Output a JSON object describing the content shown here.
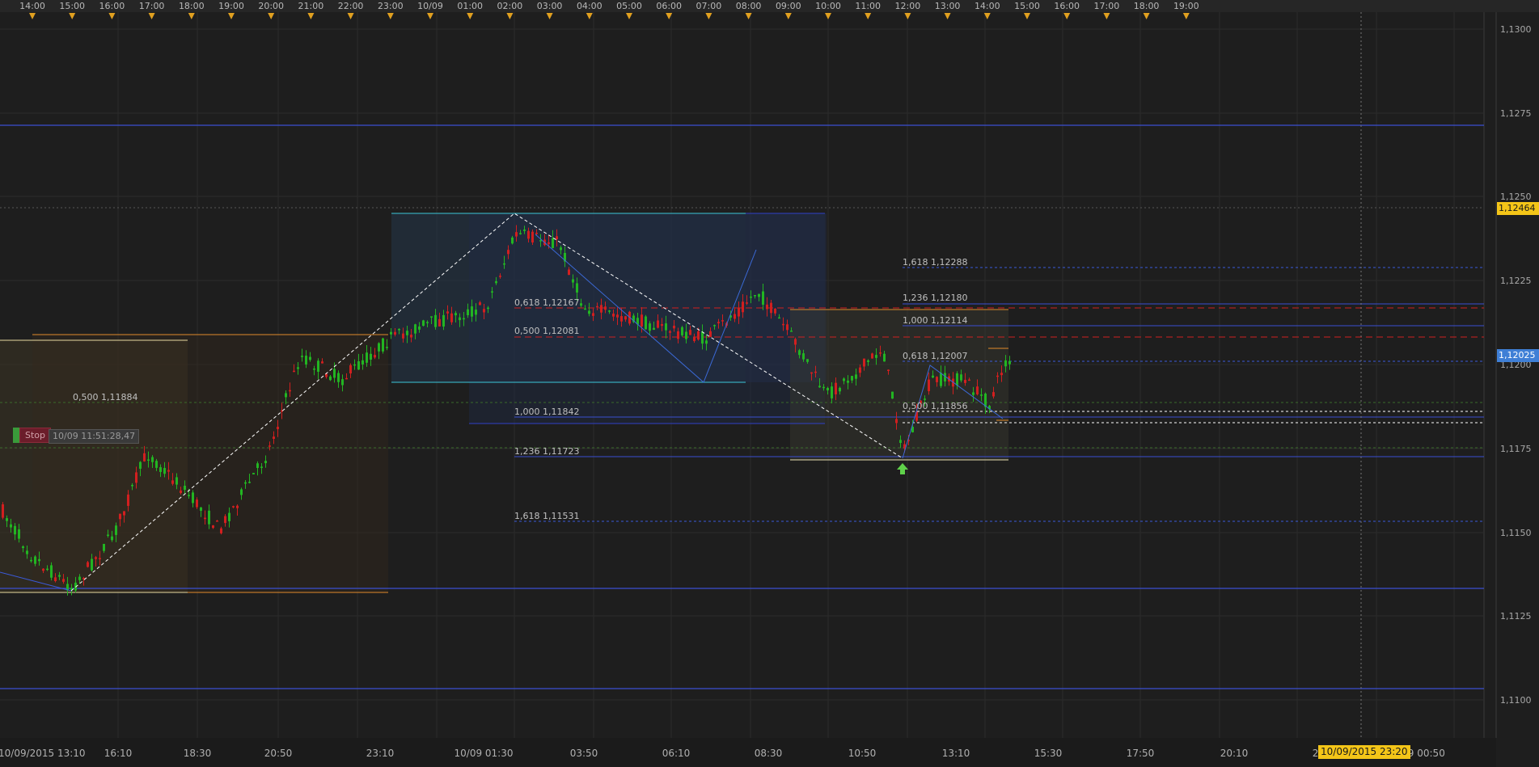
{
  "top_axis": {
    "time_labels": [
      "14:00",
      "15:00",
      "16:00",
      "17:00",
      "18:00",
      "19:00",
      "20:00",
      "21:00",
      "22:00",
      "23:00",
      "10/09",
      "01:00",
      "02:00",
      "03:00",
      "04:00",
      "05:00",
      "06:00",
      "07:00",
      "08:00",
      "09:00",
      "10:00",
      "11:00",
      "12:00",
      "13:00",
      "14:00",
      "15:00",
      "16:00",
      "17:00",
      "18:00",
      "19:00"
    ]
  },
  "bottom_axis": {
    "time_labels": [
      "10/09/2015 13:10",
      "16:10",
      "18:30",
      "20:50",
      "23:10",
      "10/09 01:30",
      "03:50",
      "06:10",
      "08:30",
      "10:50",
      "13:10",
      "15:30",
      "17:50",
      "20:10",
      "22:30",
      "09 00:50"
    ],
    "cursor_datetime": "10/09/2015 23:20"
  },
  "price_axis": {
    "labels": [
      "1,1300",
      "1,1275",
      "1,1250",
      "1,1225",
      "1,1200",
      "1,1175",
      "1,1150",
      "1,1125",
      "1,1100"
    ],
    "high_tag": "1,12464",
    "current_tag": "1,12025"
  },
  "fib_labels": {
    "left": [
      "0,500 1,11884"
    ],
    "middle": [
      "0,618 1,12167",
      "0,500 1,12081",
      "1,000 1,11842",
      "1,236 1,11723",
      "1,618 1,11531"
    ],
    "right": [
      "1,618 1,12288",
      "1,236 1,12180",
      "1,000 1,12114",
      "0,618 1,12007",
      "0,500 1,11856"
    ]
  },
  "order": {
    "stop_label": "Stop",
    "stop_time": "10/09 11:51:28,47"
  },
  "colors": {
    "background": "#1e1e1e",
    "bull_candle": "#22b522",
    "bear_candle": "#d21f1f",
    "horizontal_level": "#3b4fd1",
    "fib_dashed_blue": "#3b5ad8",
    "red_dashed": "#d02020",
    "cyan_box": "#3cc7d8",
    "orange_box": "#e08a2a",
    "high_tag": "#f4c518",
    "current_tag": "#3f7fd6"
  },
  "icons": {
    "time_marker": "orange-triangle-down-icon",
    "signal": "green-up-arrow-icon"
  }
}
